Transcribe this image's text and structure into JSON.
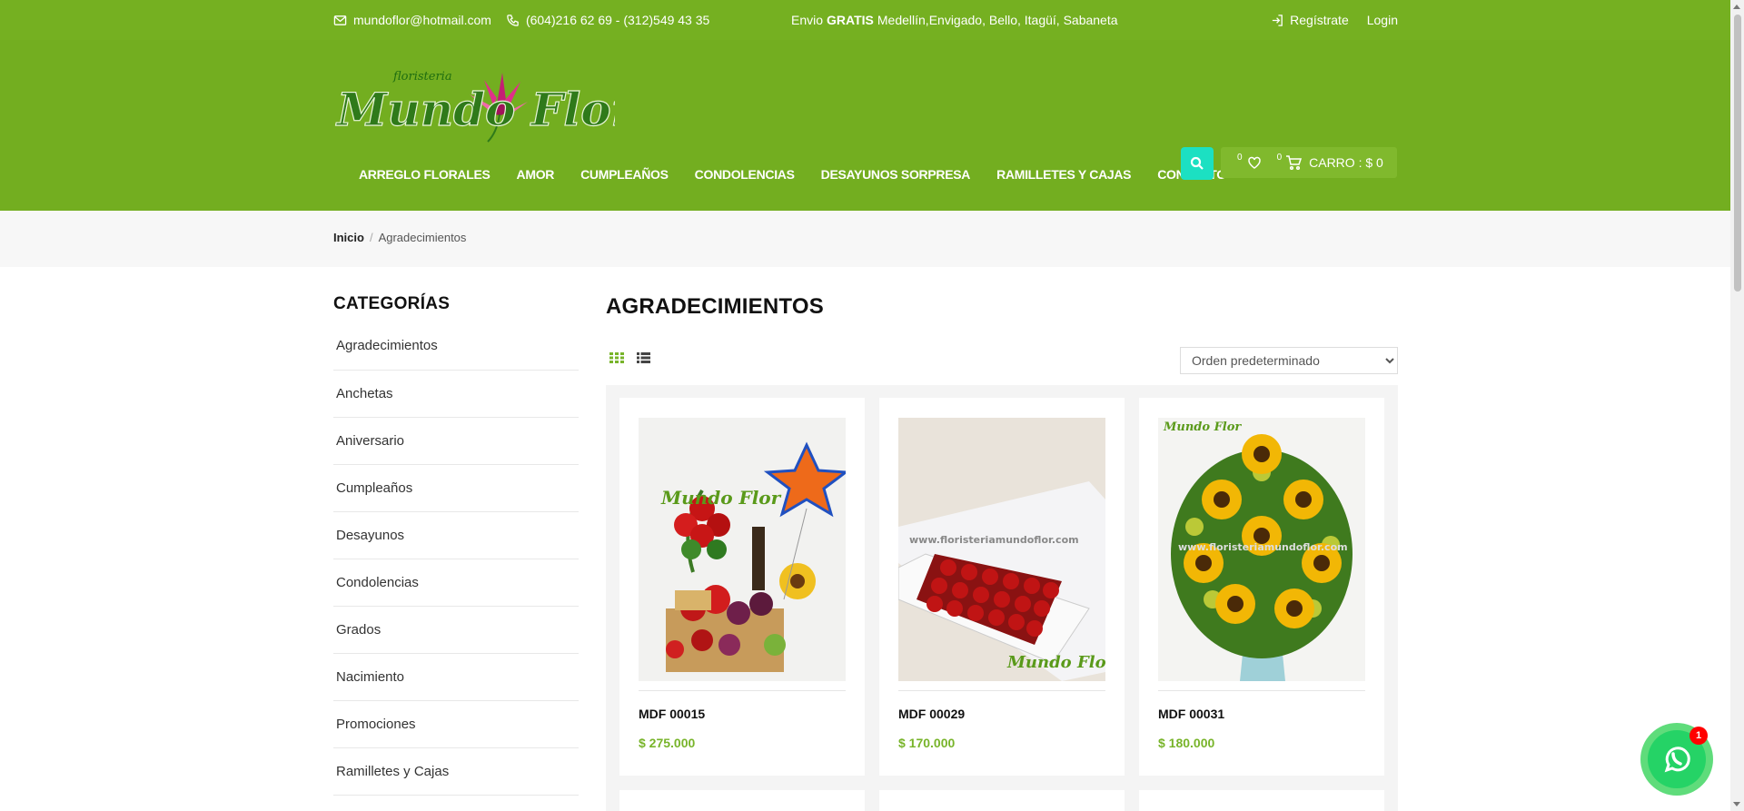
{
  "topbar": {
    "email": "mundoflor@hotmail.com",
    "phone": "(604)216 62 69 - (312)549 43 35",
    "ship_prefix": "Envio",
    "ship_bold": "GRATIS",
    "ship_rest": "Medellín,Envigado, Bello, Itagüí, Sabaneta",
    "register": "Regístrate",
    "login": "Login"
  },
  "header": {
    "logo_small": "floristeria",
    "logo_main": "Mundo Flor",
    "nav": [
      "ARREGLO FLORALES",
      "AMOR",
      "CUMPLEAÑOS",
      "CONDOLENCIAS",
      "DESAYUNOS SORPRESA",
      "RAMILLETES Y CAJAS",
      "CONTACTO"
    ],
    "wishlist_count": "0",
    "cart_count": "0",
    "cart_label": "CARRO : $ 0"
  },
  "breadcrumb": {
    "home": "Inicio",
    "sep": "/",
    "current": "Agradecimientos"
  },
  "sidebar": {
    "title": "CATEGORÍAS",
    "items": [
      "Agradecimientos",
      "Anchetas",
      "Aniversario",
      "Cumpleaños",
      "Desayunos",
      "Condolencias",
      "Grados",
      "Nacimiento",
      "Promociones",
      "Ramilletes y Cajas"
    ]
  },
  "main": {
    "title": "AGRADECIMIENTOS",
    "sort_selected": "Orden predeterminado",
    "products": [
      {
        "name": "MDF 00015",
        "price": "$ 275.000",
        "watermark": "Mundo Flor"
      },
      {
        "name": "MDF 00029",
        "price": "$ 170.000",
        "watermark": "www.floristeriamundoflor.com"
      },
      {
        "name": "MDF 00031",
        "price": "$ 180.000",
        "watermark": "www.floristeriamundoflor.com"
      }
    ]
  },
  "whatsapp": {
    "badge": "1"
  },
  "colors": {
    "topbar": "#75b021",
    "header": "#73ae20",
    "accent": "#1ce0c2",
    "price": "#78b42a"
  }
}
